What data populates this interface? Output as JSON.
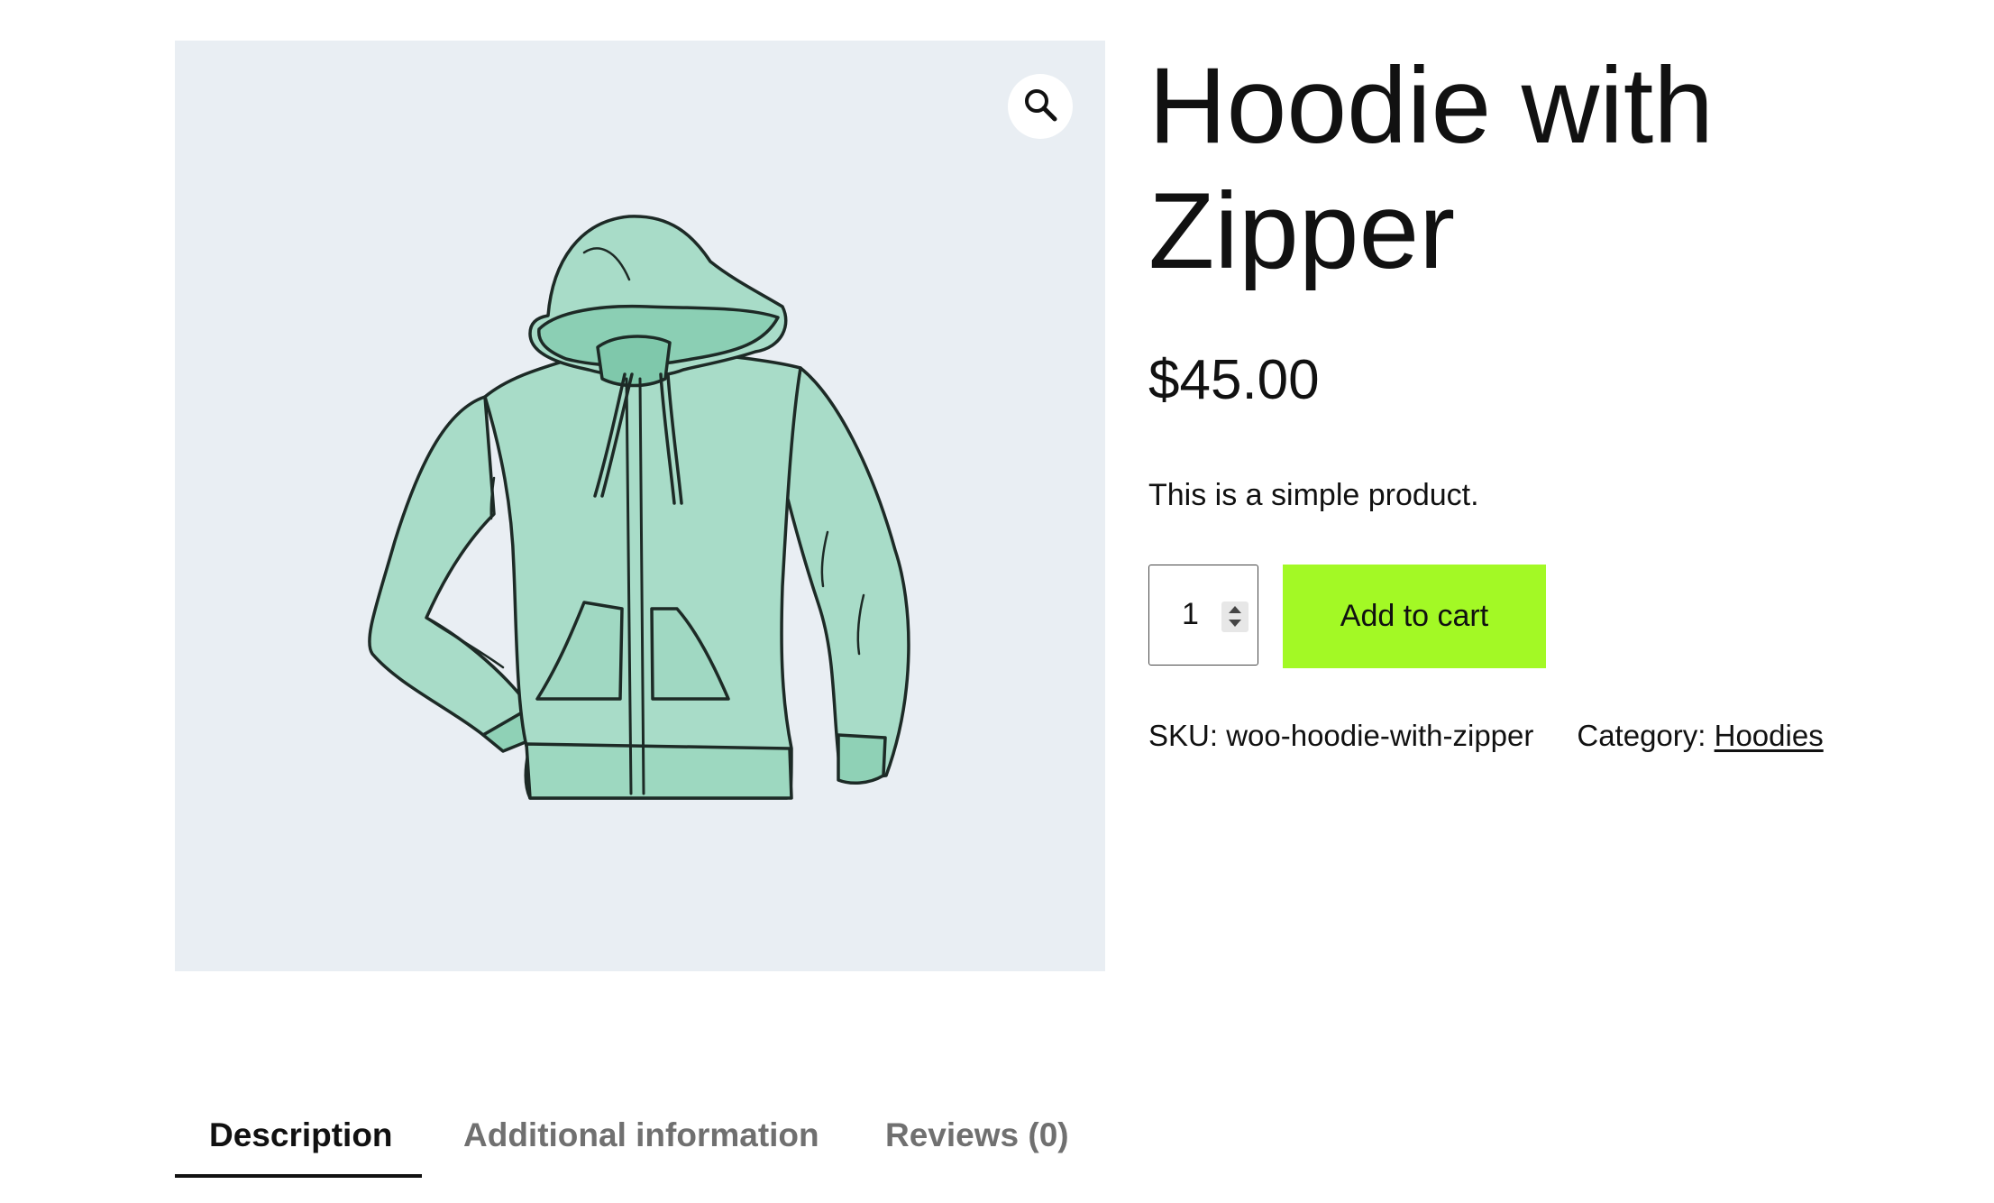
{
  "product": {
    "title": "Hoodie with Zipper",
    "price": "$45.00",
    "short_description": "This is a simple product.",
    "quantity": "1",
    "add_to_cart_label": "Add to cart",
    "sku_label": "SKU:",
    "sku_value": "woo-hoodie-with-zipper",
    "category_label": "Category:",
    "category_value": "Hoodies"
  },
  "gallery": {
    "zoom_icon": "magnifier-icon",
    "image": "hoodie-with-zipper-illustration",
    "background_color": "#e9eef3"
  },
  "tabs": [
    {
      "label": "Description",
      "active": true
    },
    {
      "label": "Additional information",
      "active": false
    },
    {
      "label": "Reviews (0)",
      "active": false
    }
  ],
  "colors": {
    "add_to_cart_bg": "#a3f925",
    "hoodie_fill": "#a8dcc8",
    "text": "#111111",
    "inactive_tab": "#707070"
  }
}
